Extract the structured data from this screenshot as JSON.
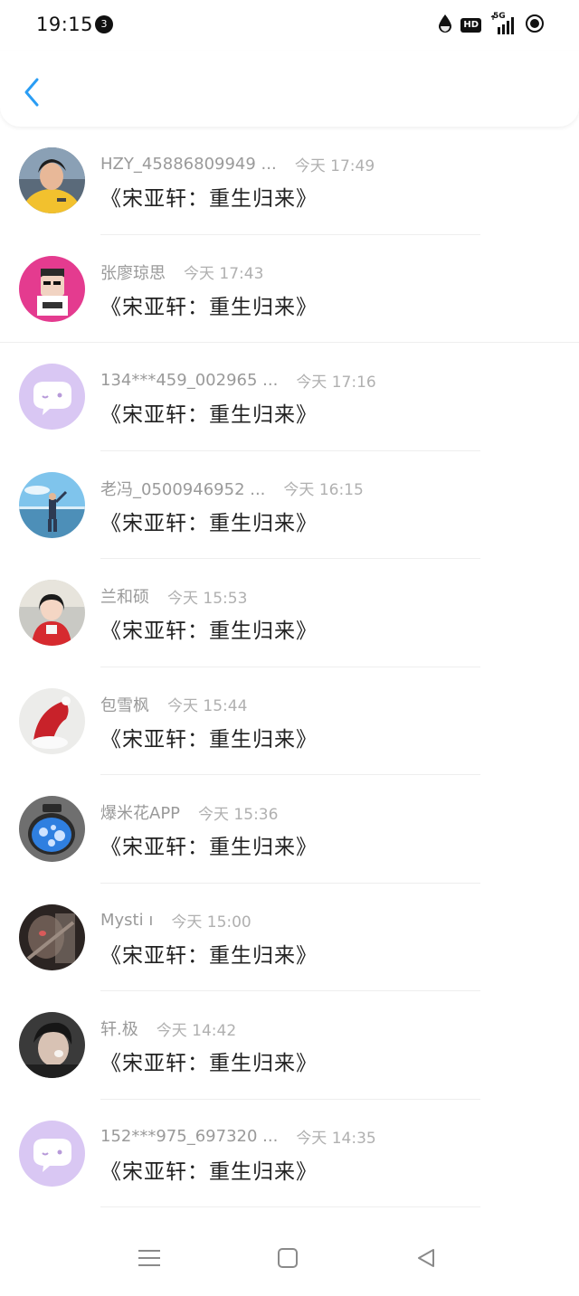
{
  "status_bar": {
    "time": "19:15",
    "notification_count": "3",
    "hd_label": "HD",
    "network_label": "5G"
  },
  "header": {
    "back_icon": "chevron-left-icon",
    "accent_color": "#2a9df4"
  },
  "items": [
    {
      "name": "HZY_45886809949 ...",
      "time": "今天 17:49",
      "title": "《宋亚轩：重生归来》",
      "avatar": "photo-boy-yellow-shirt"
    },
    {
      "name": "张廖琼思",
      "time": "今天 17:43",
      "title": "《宋亚轩：重生归来》",
      "avatar": "cartoon-pink-background"
    },
    {
      "name": "134***459_002965 ...",
      "time": "今天 17:16",
      "title": "《宋亚轩：重生归来》",
      "avatar": "default-chat-bubble"
    },
    {
      "name": "老冯_0500946952 ...",
      "time": "今天 16:15",
      "title": "《宋亚轩：重生归来》",
      "avatar": "photo-person-at-beach"
    },
    {
      "name": "兰和硕",
      "time": "今天 15:53",
      "title": "《宋亚轩：重生归来》",
      "avatar": "photo-girl-red-outfit"
    },
    {
      "name": "包雪枫",
      "time": "今天 15:44",
      "title": "《宋亚轩：重生归来》",
      "avatar": "photo-red-hat"
    },
    {
      "name": "爆米花APP",
      "time": "今天 15:36",
      "title": "《宋亚轩：重生归来》",
      "avatar": "cartoon-blue-jar"
    },
    {
      "name": "Mysti ı",
      "time": "今天 15:00",
      "title": "《宋亚轩：重生归来》",
      "avatar": "photo-dark-portrait"
    },
    {
      "name": "轩.极",
      "time": "今天 14:42",
      "title": "《宋亚轩：重生归来》",
      "avatar": "photo-dark-boy"
    },
    {
      "name": "152***975_697320 ...",
      "time": "今天 14:35",
      "title": "《宋亚轩：重生归来》",
      "avatar": "default-chat-bubble"
    }
  ],
  "nav_bar": {
    "icons": [
      "menu-icon",
      "home-square-icon",
      "back-triangle-icon"
    ]
  }
}
